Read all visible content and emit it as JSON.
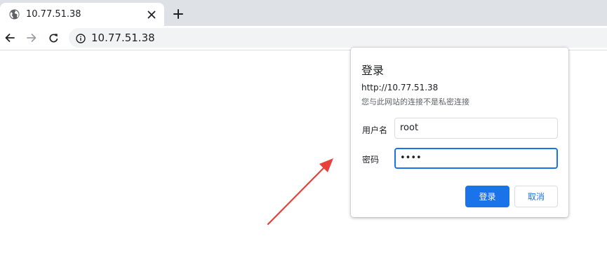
{
  "tab": {
    "title": "10.77.51.38",
    "favicon": "globe-icon",
    "close_icon": "close-icon"
  },
  "new_tab_icon": "plus-icon",
  "toolbar": {
    "back_icon": "arrow-left-icon",
    "forward_icon": "arrow-right-icon",
    "reload_icon": "reload-icon",
    "info_icon": "info-icon",
    "url": "10.77.51.38"
  },
  "dialog": {
    "title": "登录",
    "url": "http://10.77.51.38",
    "warning": "您与此网站的连接不是私密连接",
    "username_label": "用户名",
    "username_value": "root",
    "password_label": "密码",
    "password_value": "••••",
    "login_button": "登录",
    "cancel_button": "取消"
  },
  "colors": {
    "accent": "#1a73e8",
    "tabstrip": "#dee1e6",
    "omnibox": "#f1f3f4",
    "annotation_arrow": "#e8403b"
  }
}
